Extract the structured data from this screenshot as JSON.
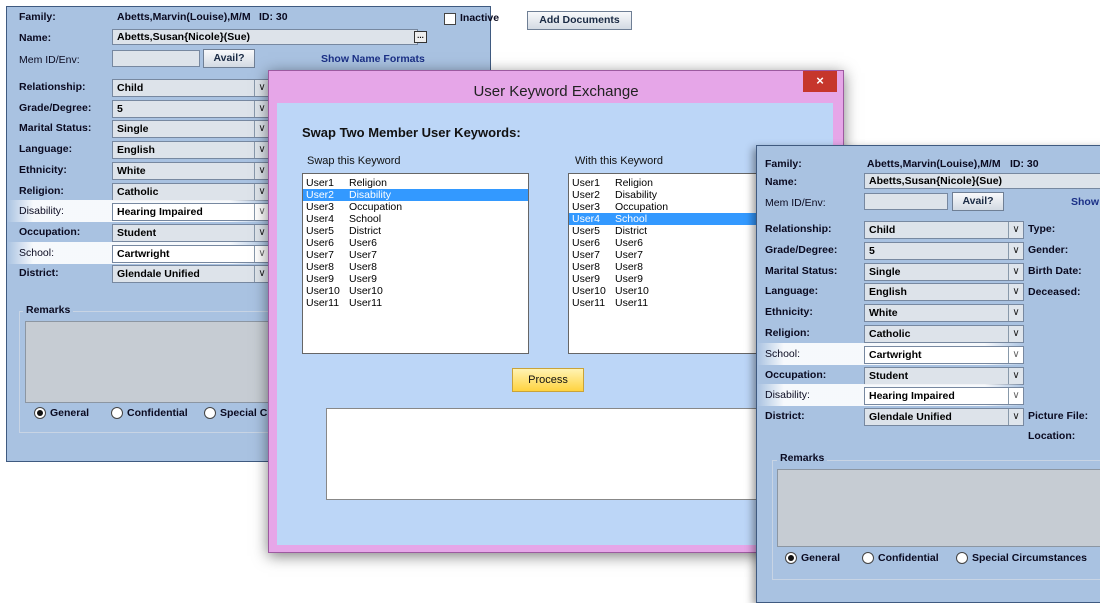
{
  "left_form": {
    "family_label": "Family:",
    "family_value": "Abetts,Marvin(Louise),M/M",
    "id_text": "ID: 30",
    "inactive_label": "Inactive",
    "add_documents": "Add Documents",
    "name_label": "Name:",
    "name_value": "Abetts,Susan{Nicole}(Sue)",
    "ellipsis": "...",
    "memid_label": "Mem ID/Env:",
    "avail": "Avail?",
    "show_name_formats": "Show Name Formats",
    "fields": [
      {
        "label": "Relationship:",
        "value": "Child"
      },
      {
        "label": "Grade/Degree:",
        "value": "5"
      },
      {
        "label": "Marital Status:",
        "value": "Single"
      },
      {
        "label": "Language:",
        "value": "English"
      },
      {
        "label": "Ethnicity:",
        "value": "White"
      },
      {
        "label": "Religion:",
        "value": "Catholic"
      },
      {
        "label": "Disability:",
        "value": "Hearing Impaired"
      },
      {
        "label": "Occupation:",
        "value": "Student"
      },
      {
        "label": "School:",
        "value": "Cartwright"
      },
      {
        "label": "District:",
        "value": "Glendale Unified"
      }
    ],
    "remarks_label": "Remarks",
    "radios": [
      "General",
      "Confidential",
      "Special Ci"
    ]
  },
  "dialog": {
    "title": "User Keyword Exchange",
    "close": "×",
    "heading": "Swap Two Member User Keywords:",
    "swap_label": "Swap this Keyword",
    "with_label": "With this Keyword",
    "list1": [
      {
        "k": "User1",
        "v": "Religion"
      },
      {
        "k": "User2",
        "v": "Disability"
      },
      {
        "k": "User3",
        "v": "Occupation"
      },
      {
        "k": "User4",
        "v": "School"
      },
      {
        "k": "User5",
        "v": "District"
      },
      {
        "k": "User6",
        "v": "User6"
      },
      {
        "k": "User7",
        "v": "User7"
      },
      {
        "k": "User8",
        "v": "User8"
      },
      {
        "k": "User9",
        "v": "User9"
      },
      {
        "k": "User10",
        "v": "User10"
      },
      {
        "k": "User11",
        "v": "User11"
      }
    ],
    "list2": [
      {
        "k": "User1",
        "v": "Religion"
      },
      {
        "k": "User2",
        "v": "Disability"
      },
      {
        "k": "User3",
        "v": "Occupation"
      },
      {
        "k": "User4",
        "v": "School"
      },
      {
        "k": "User5",
        "v": "District"
      },
      {
        "k": "User6",
        "v": "User6"
      },
      {
        "k": "User7",
        "v": "User7"
      },
      {
        "k": "User8",
        "v": "User8"
      },
      {
        "k": "User9",
        "v": "User9"
      },
      {
        "k": "User10",
        "v": "User10"
      },
      {
        "k": "User11",
        "v": "User11"
      }
    ],
    "process": "Process"
  },
  "right_form": {
    "family_label": "Family:",
    "family_value": "Abetts,Marvin(Louise),M/M",
    "id_text": "ID: 30",
    "name_label": "Name:",
    "name_value": "Abetts,Susan{Nicole}(Sue)",
    "memid_label": "Mem ID/Env:",
    "avail": "Avail?",
    "show_partial": "Show",
    "fields": [
      {
        "label": "Relationship:",
        "value": "Child"
      },
      {
        "label": "Grade/Degree:",
        "value": "5"
      },
      {
        "label": "Marital Status:",
        "value": "Single"
      },
      {
        "label": "Language:",
        "value": "English"
      },
      {
        "label": "Ethnicity:",
        "value": "White"
      },
      {
        "label": "Religion:",
        "value": "Catholic"
      },
      {
        "label": "School:",
        "value": "Cartwright"
      },
      {
        "label": "Occupation:",
        "value": "Student"
      },
      {
        "label": "Disability:",
        "value": "Hearing Impaired"
      },
      {
        "label": "District:",
        "value": "Glendale Unified"
      }
    ],
    "side_labels": [
      "Type:",
      "Gender:",
      "Birth Date:",
      "Deceased:",
      "Picture File:",
      "Location:"
    ],
    "remarks_label": "Remarks",
    "radios": [
      "General",
      "Confidential",
      "Special Circumstances"
    ]
  }
}
